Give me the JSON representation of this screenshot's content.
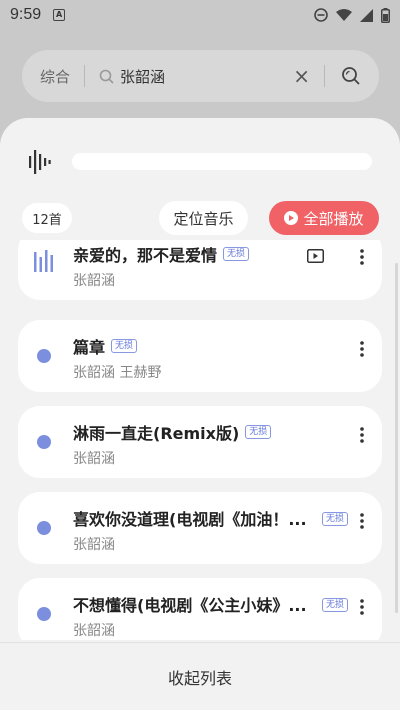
{
  "status_bar": {
    "time": "9:59",
    "notification_letter": "A",
    "icons": [
      "do-not-disturb-icon",
      "wifi-icon",
      "signal-icon",
      "battery-icon"
    ]
  },
  "search": {
    "scope": "综合",
    "query": "张韶涵"
  },
  "player": {
    "song_count": "12首",
    "locate_label": "定位音乐",
    "play_all_label": "全部播放",
    "accent_color": "#f06265"
  },
  "songs": [
    {
      "title": "亲爱的，那不是爱情",
      "artist": "张韶涵",
      "badge": "无损",
      "playing": true,
      "has_mv": true
    },
    {
      "title": "篇章",
      "artist": "张韶涵 王赫野",
      "badge": "无损"
    },
    {
      "title": "淋雨一直走(Remix版)",
      "artist": "张韶涵",
      "badge": "无损"
    },
    {
      "title": "喜欢你没道理(电视剧《加油！...",
      "artist": "张韶涵",
      "badge": "无损"
    },
    {
      "title": "不想懂得(电视剧《公主小妹》...",
      "artist": "张韶涵",
      "badge": "无损"
    }
  ],
  "collapse_label": "收起列表"
}
